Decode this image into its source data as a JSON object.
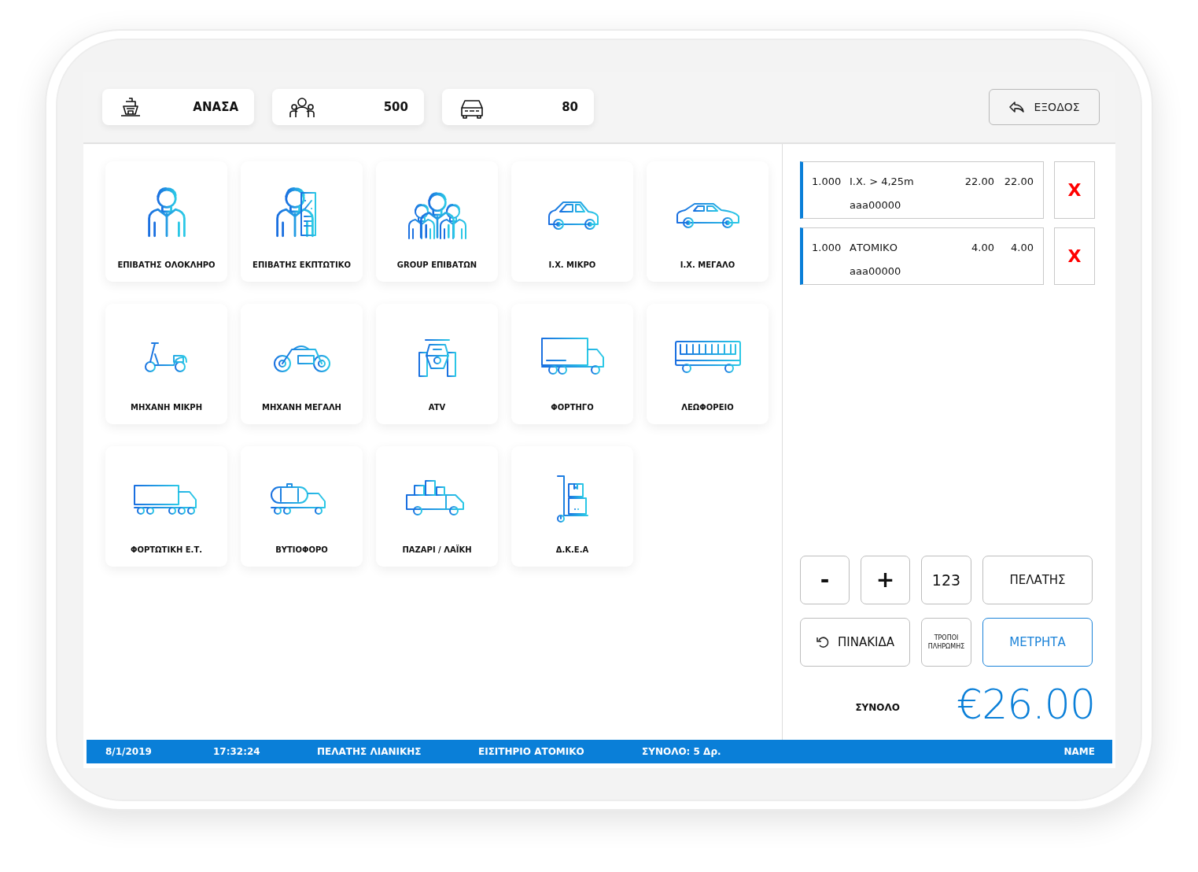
{
  "top_bar": {
    "chips": [
      {
        "kind": "ship",
        "value": "ΑΝΑΣΑ"
      },
      {
        "kind": "people",
        "value": "500"
      },
      {
        "kind": "car",
        "value": "80"
      }
    ],
    "exit_button": "ΕΞΟΔΟΣ"
  },
  "products": [
    {
      "label": "ΕΠΙΒΑΤΗΣ ΟΛΟΚΛΗΡΟ",
      "kind": "person"
    },
    {
      "label": "ΕΠΙΒΑΤΗΣ ΕΚΠΤΩΤΙΚΟ",
      "kind": "discount"
    },
    {
      "label": "GROUP ΕΠΙΒΑΤΩΝ",
      "kind": "group"
    },
    {
      "label": "Ι.Χ. ΜΙΚΡΟ",
      "kind": "smallcar"
    },
    {
      "label": "Ι.Χ. ΜΕΓΑΛΟ",
      "kind": "bigcar"
    },
    {
      "label": "ΜΗΧΑΝΗ ΜΙΚΡΗ",
      "kind": "scooter"
    },
    {
      "label": "ΜΗΧΑΝΗ ΜΕΓΑΛΗ",
      "kind": "motorcycle"
    },
    {
      "label": "ATV",
      "kind": "atv"
    },
    {
      "label": "ΦΟΡΤΗΓΟ",
      "kind": "truck"
    },
    {
      "label": "ΛΕΩΦΟΡΕΙΟ",
      "kind": "bus"
    },
    {
      "label": "ΦΟΡΤΩΤΙΚΗ Ε.Τ.",
      "kind": "trailer"
    },
    {
      "label": "ΒΥΤΙΟΦΟΡΟ",
      "kind": "tanker"
    },
    {
      "label": "ΠΑΖΑΡΙ / ΛΑΪΚΗ",
      "kind": "pickup"
    },
    {
      "label": "Δ.Κ.Ε.Α",
      "kind": "handtruck"
    }
  ],
  "ticket_lines": [
    {
      "qty": "1.000",
      "name": "Ι.Χ. > 4,25m",
      "price": "22.00",
      "total": "22.00",
      "plate": "aaa00000",
      "remove": "X"
    },
    {
      "qty": "1.000",
      "name": "ΑΤΟΜΙΚΟ",
      "price": "4.00",
      "total": "4.00",
      "plate": "aaa00000",
      "remove": "X"
    }
  ],
  "keypad": [
    {
      "label": "-",
      "kind": "symbol",
      "selected": false
    },
    {
      "label": "+",
      "kind": "symbol",
      "selected": false
    },
    {
      "label": "123",
      "kind": "number",
      "selected": false
    },
    {
      "label": "ΠΕΛΑΤΗΣ",
      "kind": "text",
      "selected": false
    },
    {
      "label": "ΠΙΝΑΚΙΔΑ",
      "kind": "undo",
      "selected": false
    },
    {
      "label": "ΤΡΟΠΟΙ ΠΛΗΡΩΜΗΣ",
      "kind": "small",
      "selected": false
    },
    {
      "label": "ΜΕΤΡΗΤΑ",
      "kind": "text",
      "selected": true
    }
  ],
  "total": {
    "label": "ΣΥΝΟΛΟ",
    "amount": "€26.00"
  },
  "status_bar": [
    "8/1/2019",
    "17:32:24",
    "ΠΕΛΑΤΗΣ ΛΙΑΝΙΚΗΣ",
    "ΕΙΣΙΤΗΡΙΟ ΑΤΟΜΙΚΟ",
    "ΣΥΝΟΛΟ: 5 Δρ.",
    "NAME"
  ]
}
